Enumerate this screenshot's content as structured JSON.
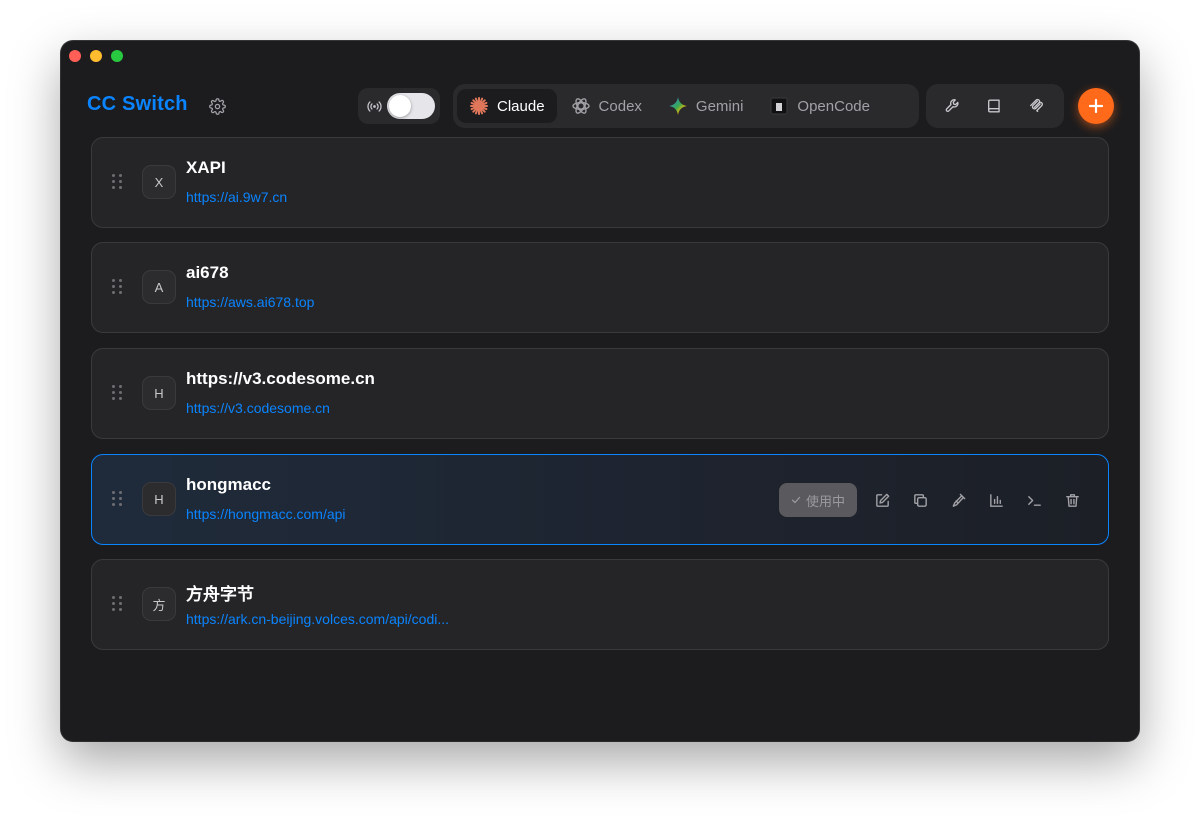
{
  "app": {
    "title": "CC Switch"
  },
  "apps": [
    {
      "label": "Claude",
      "icon": "claude-icon",
      "active": true
    },
    {
      "label": "Codex",
      "icon": "codex-icon",
      "active": false
    },
    {
      "label": "Gemini",
      "icon": "gemini-icon",
      "active": false
    },
    {
      "label": "OpenCode",
      "icon": "opencode-icon",
      "active": false
    }
  ],
  "toolbar": {
    "proxy_icon": "broadcast-icon",
    "proxy_enabled": false,
    "tools": [
      "wrench-icon",
      "book-icon",
      "mcp-icon"
    ],
    "add_icon": "plus-icon"
  },
  "providers": [
    {
      "initial": "X",
      "name": "XAPI",
      "url": "https://ai.9w7.cn",
      "active": false
    },
    {
      "initial": "A",
      "name": "ai678",
      "url": "https://aws.ai678.top",
      "active": false
    },
    {
      "initial": "H",
      "name": "https://v3.codesome.cn",
      "url": "https://v3.codesome.cn",
      "active": false
    },
    {
      "initial": "H",
      "name": "hongmacc",
      "url": "https://hongmacc.com/api",
      "active": true
    },
    {
      "initial": "方",
      "name": "方舟字节",
      "url": "https://ark.cn-beijing.volces.com/api/codi...",
      "active": false
    }
  ],
  "active_card": {
    "in_use_label": "使用中",
    "actions": [
      "edit-icon",
      "duplicate-icon",
      "test-icon",
      "usage-chart-icon",
      "terminal-icon",
      "delete-icon"
    ]
  },
  "colors": {
    "accent": "#0a84ff",
    "add_button": "#ff6a1a",
    "background": "#1c1c1e",
    "card": "#252527"
  }
}
